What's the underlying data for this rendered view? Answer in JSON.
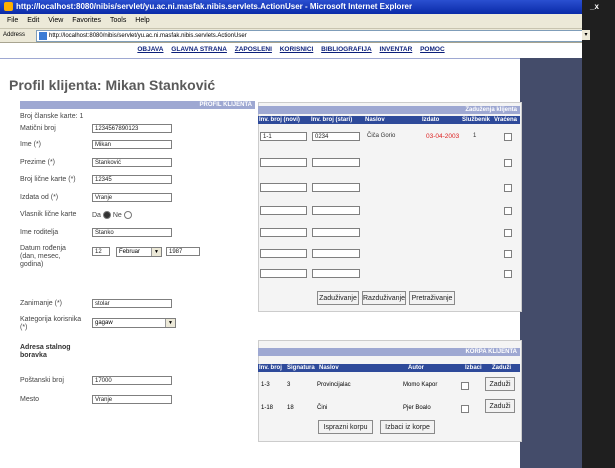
{
  "window": {
    "title": "http://localhost:8080/nibis/servlet/yu.ac.ni.masfak.nibis.servlets.ActionUser - Microsoft Internet Explorer",
    "close": "_x"
  },
  "menu": [
    "File",
    "Edit",
    "View",
    "Favorites",
    "Tools",
    "Help"
  ],
  "address": {
    "label": "Address",
    "url": "http://localhost:8080/nibis/servlet/yu.ac.ni.masfak.nibis.servlets.ActionUser"
  },
  "nav": [
    "OBJAVA",
    "GLAVNA STRANA",
    "ZAPOSLENI",
    "KORISNICI",
    "BIBLIOGRAFIJA",
    "INVENTAR",
    "POMOC"
  ],
  "page_title": "Profil klijenta: Mikan Stanković",
  "profile": {
    "header": "PROFIL KLIJENTA",
    "member_card_label": "Broj članske karte:",
    "member_card_value": "1",
    "jmbg_label": "Matični broj",
    "jmbg_value": "1234567890123",
    "name_label": "Ime (*)",
    "name_value": "Mikan",
    "surname_label": "Prezime (*)",
    "surname_value": "Stanković",
    "id_card_label": "Broj lične karte (*)",
    "id_card_value": "12345",
    "issued_label": "Izdata od (*)",
    "issued_value": "Vranje",
    "owner_label": "Vlasnik lične karte",
    "owner_yes": "Da",
    "owner_no": "Ne",
    "parent_label": "Ime roditelja",
    "parent_value": "Stanko",
    "birth_label": "Datum rođenja (dan, mesec, godina)",
    "birth_day": "12",
    "birth_month": "Februar",
    "birth_year": "1987",
    "job_label": "Zanimanje (*)",
    "job_value": "stolar",
    "category_label": "Kategorija korisnika (*)",
    "category_value": "gagaw",
    "address_label": "Adresa stalnog boravka",
    "postal_label": "Poštanski broj",
    "postal_value": "17000",
    "city_label": "Mesto",
    "city_value": "Vranje"
  },
  "loans": {
    "header": "Zaduženja klijenta",
    "columns": [
      "Inv. broj (novi)",
      "Inv. broj (stari)",
      "Naslov",
      "Izdato",
      "Službenik",
      "Vraćena"
    ],
    "rows": [
      {
        "novi": "1-1",
        "stari": "0234",
        "naslov": "Čiča Gorio",
        "izdato": "03-04-2003",
        "sluzbenik": "1"
      }
    ],
    "buttons": [
      "Zaduživanje",
      "Razduživanje",
      "Pretraživanje"
    ]
  },
  "cart": {
    "header": "KORPA KLIJENTA",
    "columns": [
      "Inv. broj",
      "Signatura",
      "Naslov",
      "Autor",
      "Izbaci",
      "Zaduži"
    ],
    "rows": [
      {
        "inv": "1-3",
        "sig": "3",
        "naslov": "Provincijalac",
        "autor": "Momo Kapor",
        "btn": "Zaduži"
      },
      {
        "inv": "1-18",
        "sig": "18",
        "naslov": "Čini",
        "autor": "Pjer Boalo",
        "btn": "Zaduži"
      }
    ],
    "buttons": [
      "Isprazni korpu",
      "Izbaci iz korpe"
    ]
  },
  "colors": {
    "header_blue": "#2e4a9a",
    "accent_red": "#d22",
    "side_dark": "#444c6a"
  }
}
